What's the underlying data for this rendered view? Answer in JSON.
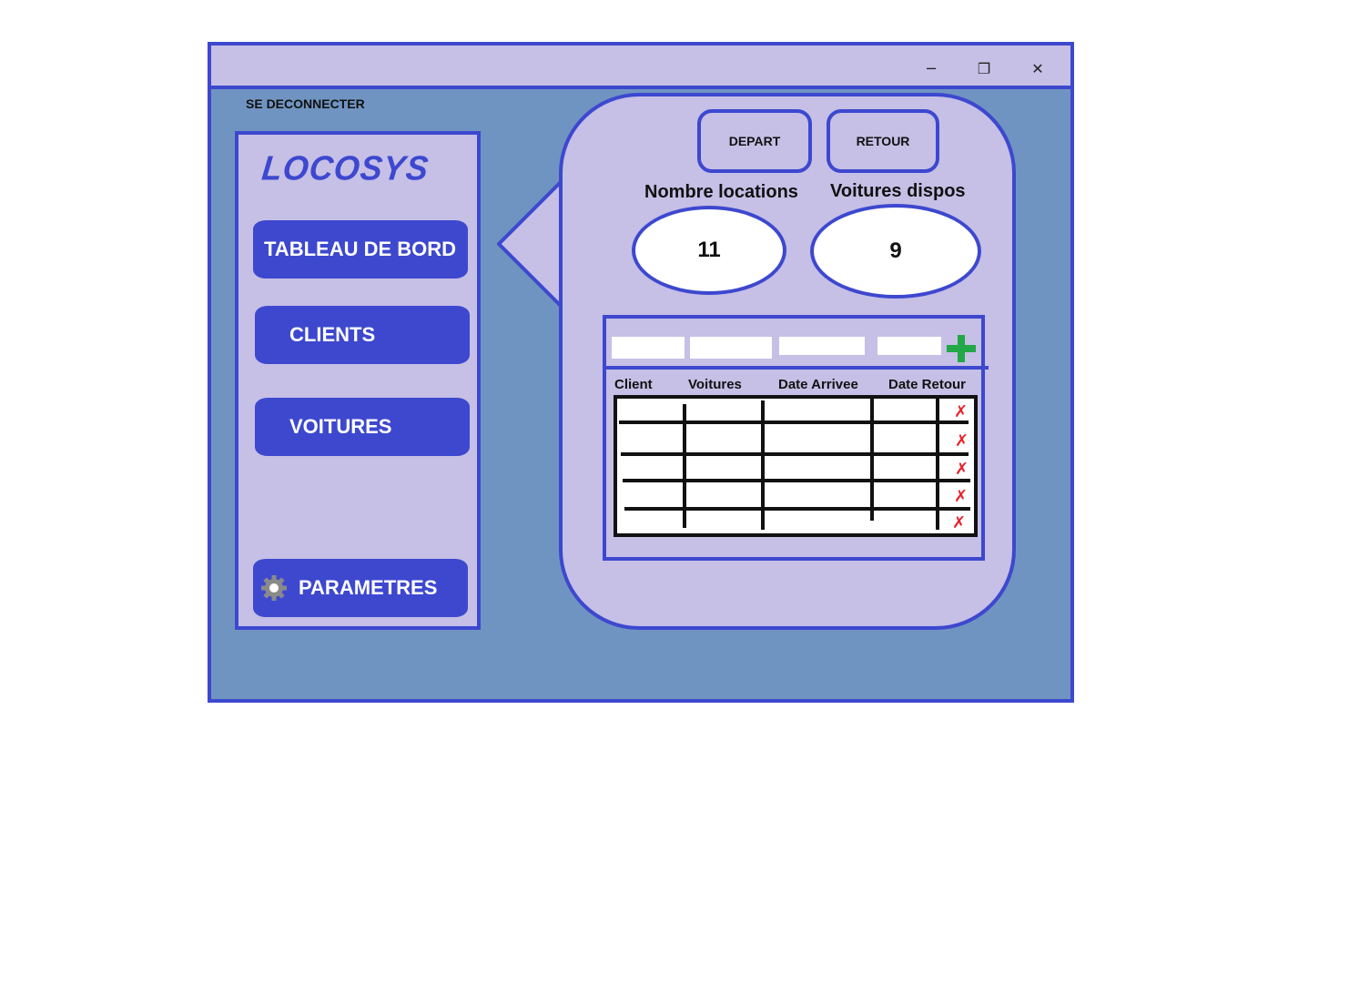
{
  "window": {
    "controls": {
      "minimize": "─",
      "restore": "❐",
      "close": "✕"
    }
  },
  "header": {
    "logout_label": "SE DECONNECTER"
  },
  "sidebar": {
    "logo": "LOCOSYS",
    "items": [
      {
        "label": "TABLEAU DE BORD"
      },
      {
        "label": "CLIENTS"
      },
      {
        "label": "VOITURES"
      }
    ],
    "settings": {
      "label": "PARAMETRES",
      "icon": "gear-icon"
    }
  },
  "dashboard": {
    "buttons": {
      "depart": "DEPART",
      "retour": "RETOUR"
    },
    "stats": {
      "locations_label": "Nombre locations",
      "locations_value": "11",
      "cars_label": "Voitures dispos",
      "cars_value": "9"
    },
    "table": {
      "filters": [
        "",
        "",
        "",
        ""
      ],
      "add_icon": "plus-icon",
      "columns": [
        "Client",
        "Voitures",
        "Date Arrivee",
        "Date Retour"
      ],
      "rows": [
        {
          "delete_glyph": "✗"
        },
        {
          "delete_glyph": "✗"
        },
        {
          "delete_glyph": "✗"
        },
        {
          "delete_glyph": "✗"
        },
        {
          "delete_glyph": "✗"
        }
      ]
    }
  },
  "colors": {
    "accent": "#3d48cf",
    "panel": "#c6bfe6",
    "background": "#7094c1",
    "add": "#22a847",
    "delete": "#e8202a"
  }
}
